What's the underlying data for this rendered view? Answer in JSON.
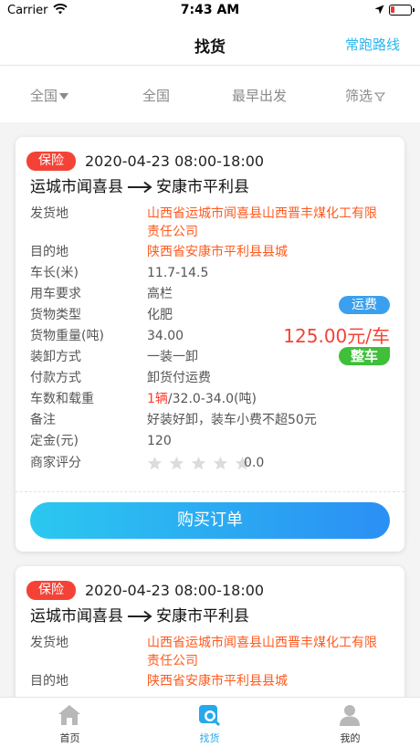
{
  "status_bar": {
    "carrier": "Carrier",
    "time": "7:43 AM"
  },
  "nav": {
    "title": "找货",
    "right_link": "常跑路线"
  },
  "filters": [
    {
      "label": "全国",
      "has_dropdown": true
    },
    {
      "label": "全国"
    },
    {
      "label": "最早出发"
    },
    {
      "label": "筛选",
      "icon": "filter-icon"
    }
  ],
  "labels": {
    "origin": "发货地",
    "destination": "目的地",
    "length": "车长(米)",
    "vehicle_req": "用车要求",
    "cargo_type": "货物类型",
    "weight": "货物重量(吨)",
    "loading": "装卸方式",
    "payment": "付款方式",
    "vehicles_load": "车数和载重",
    "remark": "备注",
    "deposit": "定金(元)",
    "rating": "商家评分"
  },
  "cards": [
    {
      "badge": "保险",
      "time_window": "2020-04-23 08:00-18:00",
      "from": "运城市闻喜县",
      "to": "安康市平利县",
      "origin": "山西省运城市闻喜县山西晋丰煤化工有限责任公司",
      "destination": "陕西省安康市平利县县城",
      "length": "11.7-14.5",
      "vehicle_req": "高栏",
      "cargo_type": "化肥",
      "weight": "34.00",
      "loading": "一装一卸",
      "payment": "卸货付运费",
      "vehicle_count": "1辆",
      "load_range": "/32.0-34.0(吨)",
      "remark": "好装好卸，装车小费不超50元",
      "deposit": "120",
      "rating_score": "0.0",
      "rating_stars": 0,
      "fee_tag": "运费",
      "price": "125.00元/车",
      "type_tag": "整车",
      "buy_label": "购买订单"
    },
    {
      "badge": "保险",
      "time_window": "2020-04-23 08:00-18:00",
      "from": "运城市闻喜县",
      "to": "安康市平利县",
      "origin": "山西省运城市闻喜县山西晋丰煤化工有限责任公司",
      "destination": "陕西省安康市平利县县城"
    }
  ],
  "tabs": [
    {
      "label": "首页",
      "icon": "home-icon",
      "active": false
    },
    {
      "label": "找货",
      "icon": "find-goods-icon",
      "active": true
    },
    {
      "label": "我的",
      "icon": "profile-icon",
      "active": false
    }
  ],
  "colors": {
    "accent": "#27b6f0",
    "badge_red": "#f44336",
    "orange_text": "#ff5a1f",
    "green_tag": "#3fbf3a",
    "blue_tag": "#3aa0ee"
  }
}
